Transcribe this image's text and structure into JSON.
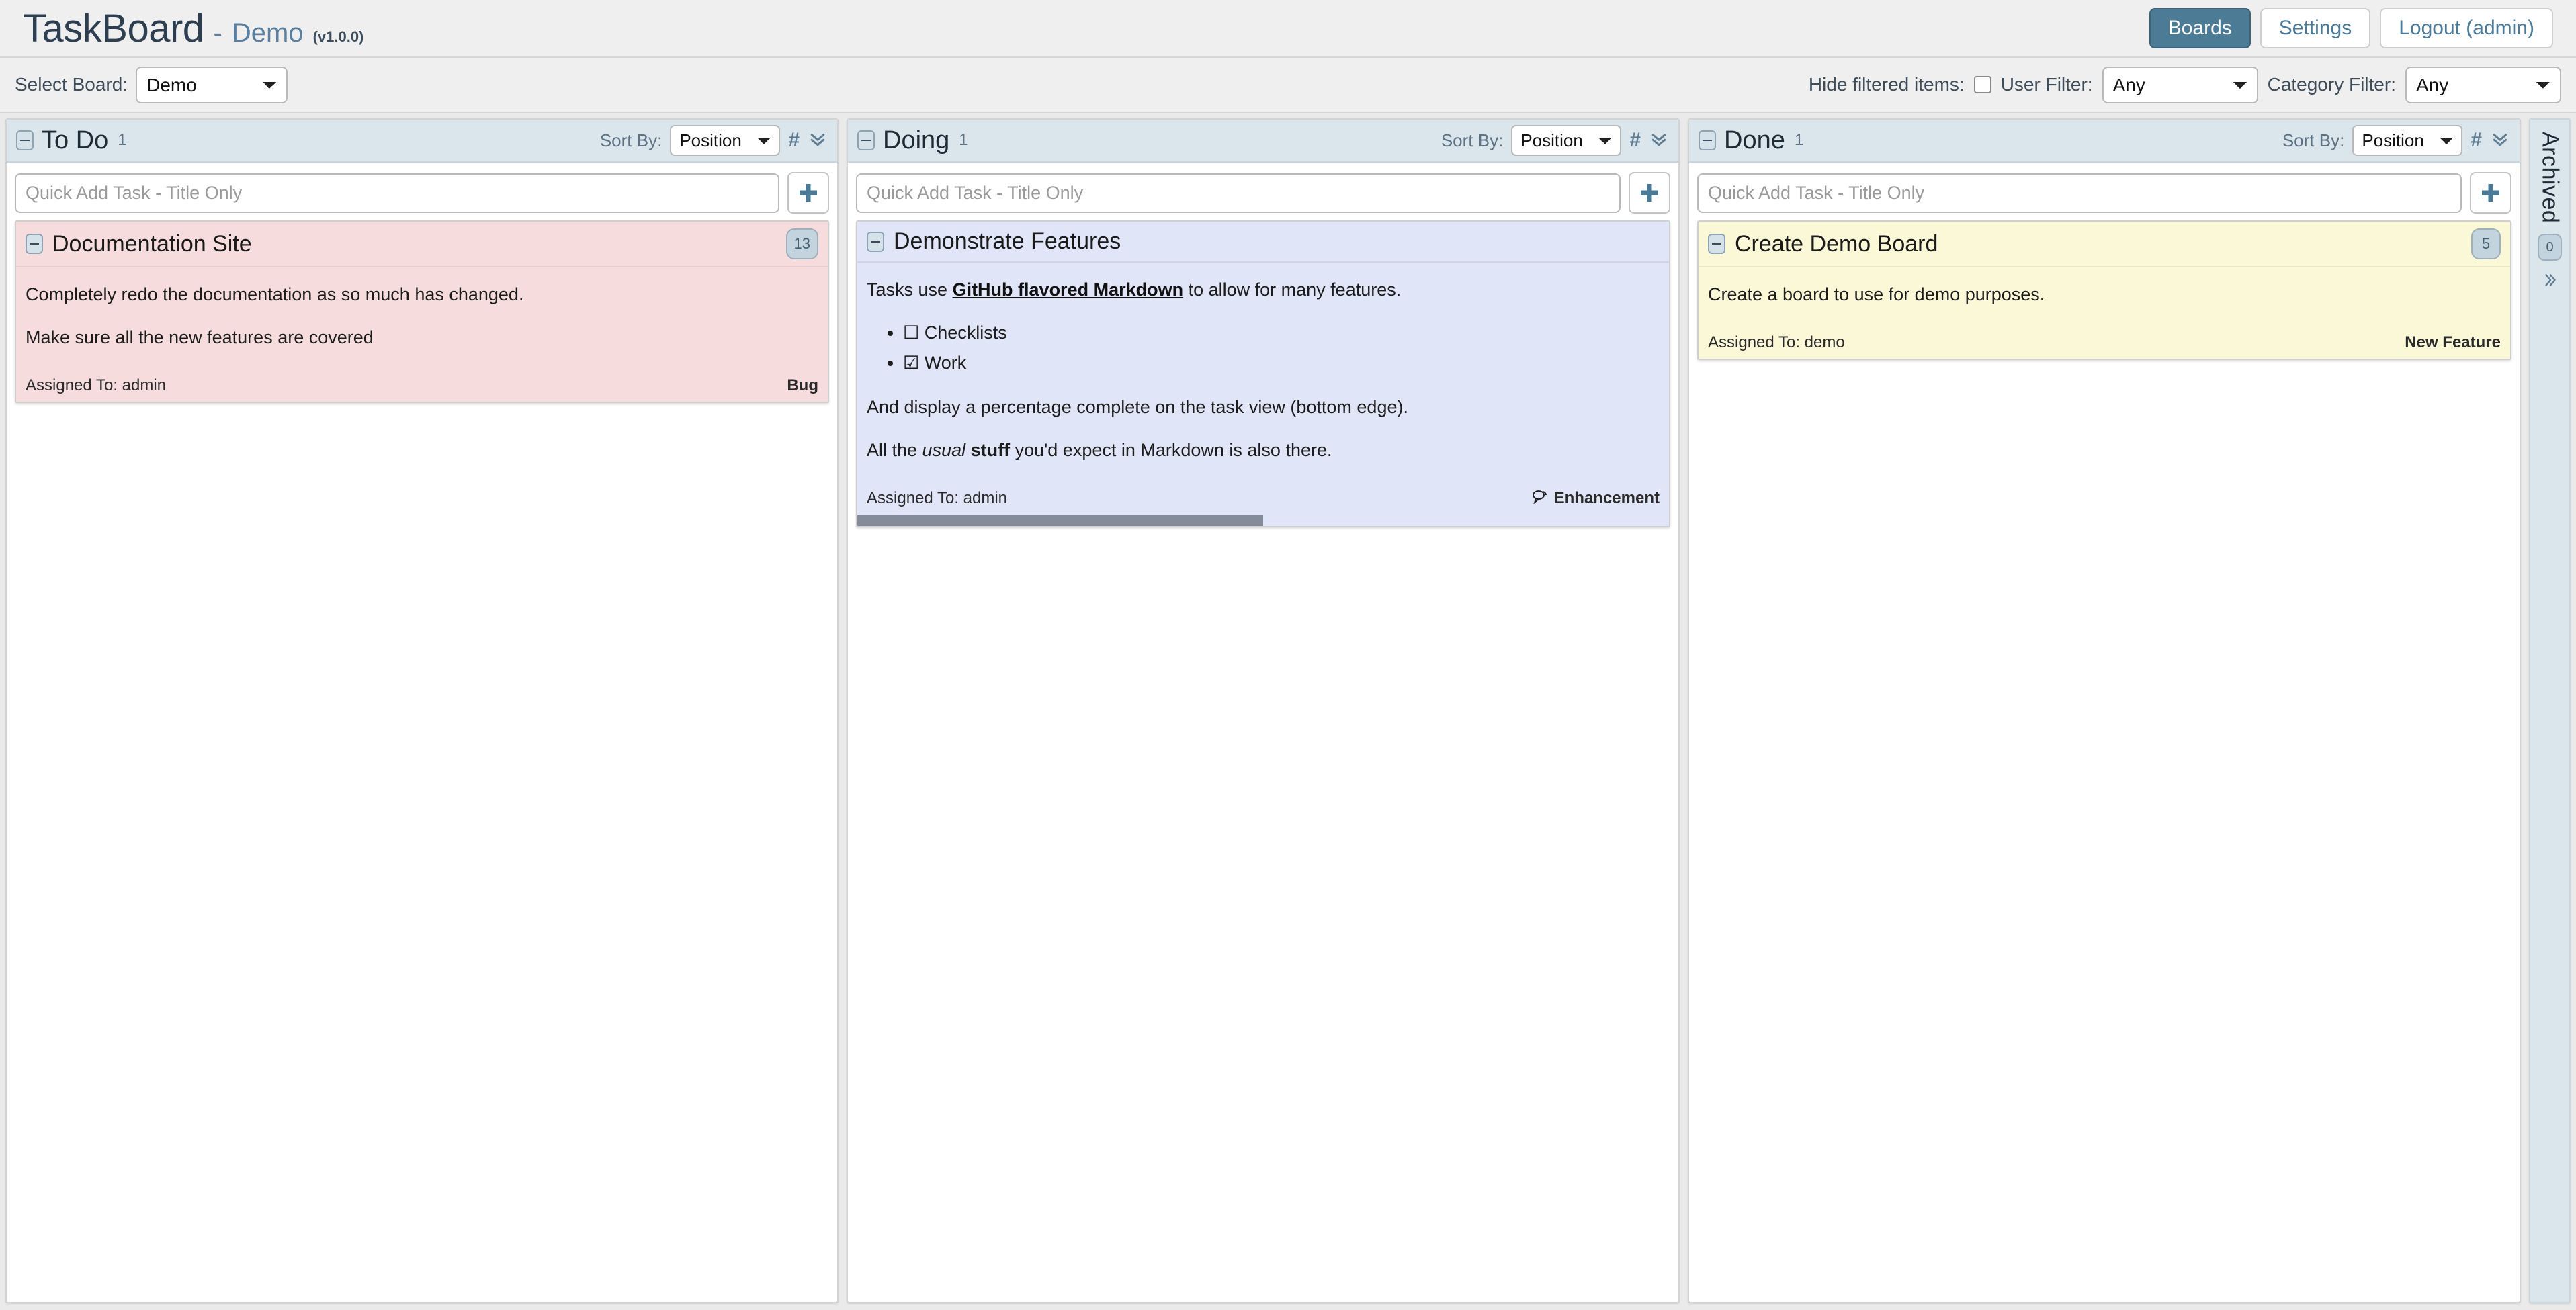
{
  "header": {
    "app_title": "TaskBoard",
    "separator": "-",
    "board_name": "Demo",
    "version": "(v1.0.0)",
    "nav": [
      {
        "label": "Boards",
        "active": true
      },
      {
        "label": "Settings",
        "active": false
      },
      {
        "label": "Logout (admin)",
        "active": false
      }
    ]
  },
  "filterbar": {
    "select_board_label": "Select Board:",
    "board_value": "Demo",
    "hide_filtered_label": "Hide filtered items:",
    "hide_filtered_checked": false,
    "user_filter_label": "User Filter:",
    "user_filter_value": "Any",
    "category_filter_label": "Category Filter:",
    "category_filter_value": "Any"
  },
  "common": {
    "sort_by_label": "Sort By:",
    "sort_value": "Position",
    "hash_icon": "#",
    "collapse_all_icon": "chevron-double-down-icon",
    "quick_add_placeholder": "Quick Add Task - Title Only",
    "add_icon": "plus-icon",
    "assigned_prefix": "Assigned To: "
  },
  "columns": [
    {
      "name": "To Do",
      "count": "1",
      "sort_value": "Position",
      "quick_add_value": "",
      "cards": [
        {
          "title": "Documentation Site",
          "badge": "13",
          "color": "card-red",
          "paragraphs": [
            "Completely redo the documentation as so much has changed.",
            "Make sure all the new features are covered"
          ],
          "assigned": "Assigned To: admin",
          "category": "Bug",
          "category_icon": "",
          "progress": null
        }
      ]
    },
    {
      "name": "Doing",
      "count": "1",
      "sort_value": "Position",
      "quick_add_value": "",
      "cards": [
        {
          "title": "Demonstrate Features",
          "badge": "",
          "color": "card-blue",
          "rich": {
            "line1_pre": "Tasks use ",
            "line1_link": "GitHub flavored Markdown",
            "line1_post": " to allow for many features.",
            "checklist": [
              {
                "checked": false,
                "label": "Checklists"
              },
              {
                "checked": true,
                "label": "Work"
              }
            ],
            "line2": "And display a percentage complete on the task view (bottom edge).",
            "line3_pre": "All the ",
            "line3_em": "usual",
            "line3_strong": "stuff",
            "line3_post": " you'd expect in Markdown is also there."
          },
          "assigned": "Assigned To: admin",
          "category": "Enhancement",
          "category_icon": "comment-icon",
          "progress": 50
        }
      ]
    },
    {
      "name": "Done",
      "count": "1",
      "sort_value": "Position",
      "quick_add_value": "",
      "cards": [
        {
          "title": "Create Demo Board",
          "badge": "5",
          "color": "card-yellow",
          "paragraphs": [
            "Create a board to use for demo purposes."
          ],
          "assigned": "Assigned To: demo",
          "category": "New Feature",
          "category_icon": "",
          "progress": null
        }
      ]
    }
  ],
  "archived": {
    "label": "Archived",
    "count": "0",
    "expand_icon": "chevron-double-right-icon"
  },
  "colors": {
    "accent": "#4c7b96",
    "header_bg": "#efefef",
    "column_head_bg": "#dbe5ec",
    "card_red": "#f6dcdc",
    "card_blue": "#e1e5f8",
    "card_yellow": "#fbf8d8",
    "progress_fill": "#848c99"
  }
}
